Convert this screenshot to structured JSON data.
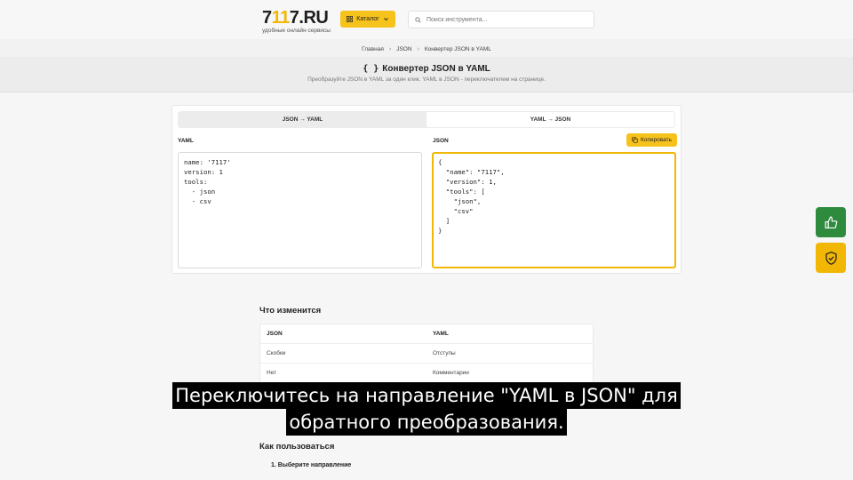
{
  "header": {
    "logo_a": "7",
    "logo_b": "11",
    "logo_c": "7.RU",
    "logo_sub": "удобные онлайн сервисы",
    "catalog_label": "Каталог",
    "search_placeholder": "Поиск инструмента..."
  },
  "breadcrumb": [
    "Главная",
    "JSON",
    "Конвертер JSON в YAML"
  ],
  "page": {
    "title_icon": "{ }",
    "title": "Конвертер JSON в YAML",
    "subtitle": "Преобразуйте JSON в YAML за один клик. YAML в JSON - переключателем на странице."
  },
  "converter": {
    "tabs": [
      {
        "label": "JSON → YAML",
        "active": false
      },
      {
        "label": "YAML → JSON",
        "active": true
      }
    ],
    "left_label": "YAML",
    "right_label": "JSON",
    "copy_label": "Копировать",
    "input_text": "name: '7117'\nversion: 1\ntools:\n  - json\n  - csv",
    "output_text": "{\n  \"name\": \"7117\",\n  \"version\": 1,\n  \"tools\": [\n    \"json\",\n    \"csv\"\n  ]\n}"
  },
  "changes": {
    "title": "Что изменится",
    "headers": [
      "JSON",
      "YAML"
    ],
    "rows": [
      [
        "Скобки",
        "Отступы"
      ],
      [
        "Нет",
        "Комментарии"
      ]
    ]
  },
  "howto": {
    "title": "Как пользоваться",
    "step1": "1. Выберите направление"
  },
  "caption": {
    "line1": "Переключитесь на направление \"YAML в JSON\" для",
    "line2": "обратного преобразования."
  },
  "colors": {
    "accent": "#f6c21c",
    "like": "#2e8b3e",
    "shield": "#f2b705"
  },
  "icons": [
    "catalog-grid-icon",
    "chevron-down-icon",
    "search-icon",
    "chevron-right-icon",
    "copy-icon",
    "thumbs-up-icon",
    "shield-check-icon"
  ]
}
